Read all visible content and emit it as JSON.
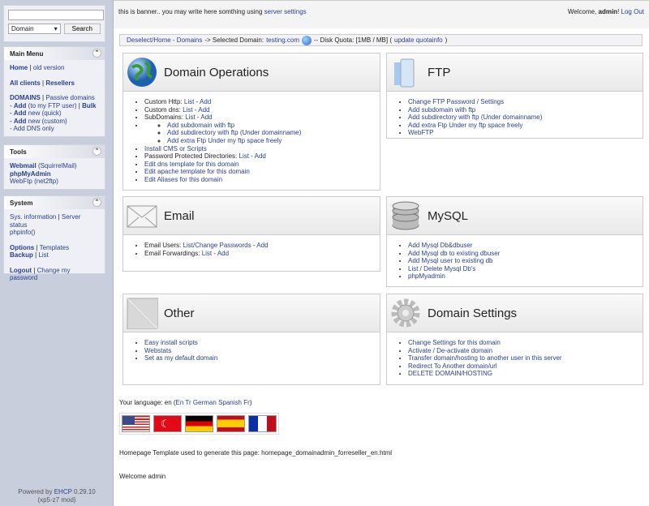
{
  "search": {
    "placeholder": "",
    "select": "Domain",
    "button": "Search"
  },
  "menus": [
    {
      "title": "Main Menu",
      "lines": [
        [
          {
            "t": "Home",
            "l": 1,
            "b": 1
          },
          {
            "t": " | "
          },
          {
            "t": "old version",
            "l": 1
          }
        ],
        [],
        [
          {
            "t": "All clients",
            "l": 1,
            "b": 1
          },
          {
            "t": " | "
          },
          {
            "t": "Resellers",
            "l": 1,
            "b": 1
          }
        ],
        [],
        [
          {
            "t": "DOMAINS",
            "l": 1,
            "b": 1
          },
          {
            "t": " | "
          },
          {
            "t": "Passive domains",
            "l": 1
          }
        ],
        [
          {
            "t": "- "
          },
          {
            "t": "Add",
            "l": 1,
            "b": 1
          },
          {
            "t": " (to my FTP user)",
            "l": 1
          },
          {
            "t": " | "
          },
          {
            "t": "Bulk",
            "l": 1,
            "b": 1
          }
        ],
        [
          {
            "t": "- "
          },
          {
            "t": "Add",
            "l": 1,
            "b": 1
          },
          {
            "t": " new (quick)",
            "l": 1
          }
        ],
        [
          {
            "t": "- "
          },
          {
            "t": "Add",
            "l": 1,
            "b": 1
          },
          {
            "t": " new (custom)",
            "l": 1
          }
        ],
        [
          {
            "t": "- Add DNS only",
            "l": 1
          }
        ]
      ]
    },
    {
      "title": "Tools",
      "lines": [
        [
          {
            "t": "Webmail",
            "l": 1,
            "b": 1
          },
          {
            "t": " (SquirrelMail)",
            "l": 1
          }
        ],
        [
          {
            "t": "phpMyAdmin",
            "l": 1,
            "b": 1
          }
        ],
        [
          {
            "t": "WebFtp (net2ftp)",
            "l": 1
          }
        ]
      ]
    },
    {
      "title": "System",
      "lines": [
        [
          {
            "t": "Sys. information",
            "l": 1
          },
          {
            "t": " | "
          },
          {
            "t": "Server status",
            "l": 1
          }
        ],
        [
          {
            "t": "phpinfo()",
            "l": 1
          }
        ],
        [],
        [
          {
            "t": "Options",
            "l": 1,
            "b": 1
          },
          {
            "t": " | "
          },
          {
            "t": "Templates",
            "l": 1
          }
        ],
        [
          {
            "t": "Backup",
            "l": 1,
            "b": 1
          },
          {
            "t": " | "
          },
          {
            "t": "List",
            "l": 1
          }
        ],
        [],
        [
          {
            "t": "Logout",
            "l": 1,
            "b": 1
          },
          {
            "t": " | "
          },
          {
            "t": "Change my password",
            "l": 1
          }
        ]
      ]
    }
  ],
  "footer": {
    "powered": "Powered by ",
    "ehcp": "EHCP",
    "version": " 0.29.10",
    "mod": "(xp5-z7 mod)"
  },
  "banner": {
    "text": "this is banner.. you may write here somthing using ",
    "link": "server settings",
    "welcome": "Welcome, ",
    "user": "admin",
    "excl": "!",
    "logout": "Log Out"
  },
  "crumb": {
    "home": "Deselect/Home - Domains",
    "sel": " -> Selected Domain: ",
    "domain": "testing.com",
    "quota": " -- Disk Quota: [1MB / MB] (",
    "update": "update quotainfo",
    "close": ")"
  },
  "panels": [
    {
      "title": "Domain Operations",
      "icon": "globe",
      "items": [
        [
          {
            "t": "Custom Http: "
          },
          {
            "t": "List",
            "l": 1
          },
          {
            "t": " - "
          },
          {
            "t": "Add",
            "l": 1
          }
        ],
        [
          {
            "t": "Custom dns: "
          },
          {
            "t": "List",
            "l": 1
          },
          {
            "t": " - "
          },
          {
            "t": "Add",
            "l": 1
          }
        ],
        [
          {
            "t": "SubDomains: "
          },
          {
            "t": "List",
            "l": 1
          },
          {
            "t": " - "
          },
          {
            "t": "Add",
            "l": 1
          }
        ],
        {
          "sub": [
            [
              {
                "t": "Add subdomain with ftp",
                "l": 1
              }
            ],
            [
              {
                "t": "Add subdirectory with ftp (Under domainname)",
                "l": 1
              }
            ],
            [
              {
                "t": "Add extra Ftp Under my ftp space freely",
                "l": 1
              }
            ]
          ]
        },
        [
          {
            "t": "Install CMS or Scripts",
            "l": 1
          }
        ],
        [
          {
            "t": "Password Protected Directories: "
          },
          {
            "t": "List",
            "l": 1
          },
          {
            "t": " - "
          },
          {
            "t": "Add",
            "l": 1
          }
        ],
        [
          {
            "t": "Edit dns template for this domain",
            "l": 1
          }
        ],
        [
          {
            "t": "Edit apache template for this domain",
            "l": 1
          }
        ],
        [
          {
            "t": "Edit Aliases for this domain",
            "l": 1
          }
        ]
      ]
    },
    {
      "title": "FTP",
      "icon": "folder",
      "items": [
        [
          {
            "t": "Change FTP Password / Settings",
            "l": 1
          }
        ],
        [
          {
            "t": "Add subdomain with ftp",
            "l": 1
          }
        ],
        [
          {
            "t": "Add subdirectory with ftp (Under domainname)",
            "l": 1
          }
        ],
        [
          {
            "t": "Add extra Ftp Under my ftp space freely",
            "l": 1
          }
        ],
        [
          {
            "t": "WebFTP",
            "l": 1
          }
        ]
      ]
    },
    {
      "title": "Email",
      "icon": "envelope",
      "items": [
        [
          {
            "t": "Email Users: "
          },
          {
            "t": "List/Change Passwords",
            "l": 1
          },
          {
            "t": " - "
          },
          {
            "t": "Add",
            "l": 1
          }
        ],
        [
          {
            "t": "Email Forwardings: "
          },
          {
            "t": "List",
            "l": 1
          },
          {
            "t": " - "
          },
          {
            "t": "Add",
            "l": 1
          }
        ]
      ]
    },
    {
      "title": "MySQL",
      "icon": "database",
      "items": [
        [
          {
            "t": "Add Mysql Db&dbuser",
            "l": 1
          }
        ],
        [
          {
            "t": "Add Mysql db to existing dbuser",
            "l": 1
          }
        ],
        [
          {
            "t": "Add Mysql user to existing db",
            "l": 1
          }
        ],
        [
          {
            "t": "List / Delete Mysql Db's",
            "l": 1
          }
        ],
        [
          {
            "t": "phpMyadmin",
            "l": 1
          }
        ]
      ]
    },
    {
      "title": "Other",
      "icon": "blank",
      "items": [
        [
          {
            "t": "Easy install scripts",
            "l": 1
          }
        ],
        [
          {
            "t": "Webstats",
            "l": 1
          }
        ],
        [
          {
            "t": "Set as my default domain",
            "l": 1
          }
        ]
      ]
    },
    {
      "title": "Domain Settings",
      "icon": "gear",
      "items": [
        [
          {
            "t": "Change Settings for this domain",
            "l": 1
          }
        ],
        [
          {
            "t": "Activate / De-activate domain",
            "l": 1
          }
        ],
        [
          {
            "t": "Transfer domain/hosting to another user in this server",
            "l": 1
          }
        ],
        [
          {
            "t": "Redirect To Another domain/url",
            "l": 1
          }
        ],
        [
          {
            "t": "DELETE DOMAIN/HOSTING",
            "l": 1
          }
        ]
      ]
    }
  ],
  "language": {
    "label": "Your language: en (",
    "links": [
      "En",
      "Tr",
      "German",
      "Spanish",
      "Fr"
    ],
    "close": ")"
  },
  "flags": [
    "us",
    "tr",
    "de",
    "es",
    "fr"
  ],
  "template": "Homepage Template used to generate this page: homepage_domainadmin_forreseller_en.html",
  "welcome": "Welcome admin"
}
